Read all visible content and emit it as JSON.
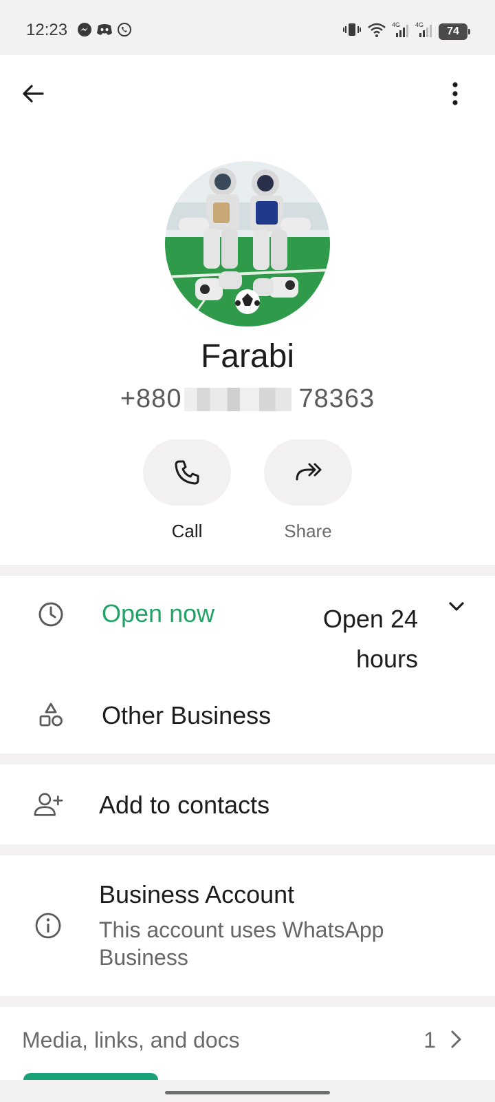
{
  "status_bar": {
    "time": "12:23",
    "battery": "74",
    "network_1": "4G",
    "network_2": "4G"
  },
  "contact": {
    "name": "Farabi",
    "phone_prefix": "+880",
    "phone_suffix": "78363"
  },
  "actions": [
    {
      "label": "Call",
      "icon": "phone-icon"
    },
    {
      "label": "Share",
      "icon": "share-icon"
    }
  ],
  "hours": {
    "status": "Open now",
    "hours": "Open 24 hours",
    "status_color": "#21a366"
  },
  "category": "Other Business",
  "add_contact": "Add to contacts",
  "business_account": {
    "title": "Business Account",
    "description": "This account uses WhatsApp Business"
  },
  "media": {
    "label": "Media, links, and docs",
    "count": "1"
  },
  "colors": {
    "accent": "#1aa37a",
    "open_green": "#21a366",
    "background": "#f3f2f0"
  }
}
